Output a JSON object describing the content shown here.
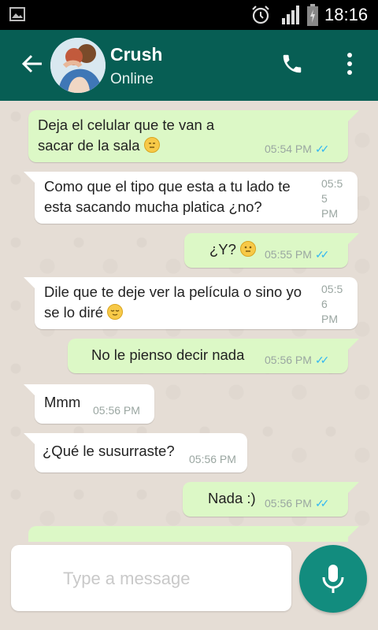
{
  "status_bar": {
    "time": "18:16"
  },
  "header": {
    "contact_name": "Crush",
    "contact_status": "Online"
  },
  "messages": [
    {
      "direction": "out",
      "line1": "Deja el celular que te van a",
      "line2": "sacar de la sala",
      "emoji": "expressionless-face",
      "time": "05:54 PM",
      "ticks": "read"
    },
    {
      "direction": "in",
      "line1": "Como que el tipo que esta a tu lado te",
      "line2": "esta sacando mucha platica ¿no?",
      "time_line1": "05:5",
      "time_line2": "5",
      "time_line3": "PM"
    },
    {
      "direction": "out",
      "text": "¿Y?",
      "emoji": "neutral-face",
      "time": "05:55 PM",
      "ticks": "read"
    },
    {
      "direction": "in",
      "line1": "Dile que te deje ver la película o sino yo",
      "line2": "se lo diré",
      "emoji": "relieved-face",
      "time_line1": "05:5",
      "time_line2": "6",
      "time_line3": "PM"
    },
    {
      "direction": "out",
      "text": "No le pienso decir nada",
      "time": "05:56 PM",
      "ticks": "read"
    },
    {
      "direction": "in",
      "text": "Mmm",
      "time": "05:56 PM"
    },
    {
      "direction": "in",
      "text": "¿Qué le susurraste?",
      "time": "05:56 PM"
    },
    {
      "direction": "out",
      "text": "Nada :)",
      "time": "05:56 PM",
      "ticks": "read"
    }
  ],
  "composer": {
    "placeholder": "Type a message"
  },
  "colors": {
    "header": "#075e54",
    "outgoing_bubble": "#dcf8c6",
    "incoming_bubble": "#ffffff",
    "mic_button": "#128c7e",
    "read_ticks": "#34b7f1"
  }
}
